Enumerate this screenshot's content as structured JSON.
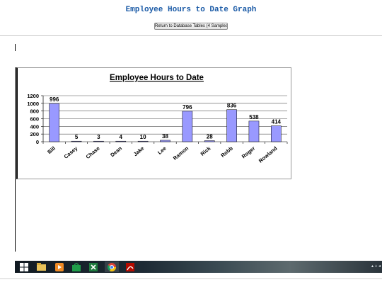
{
  "page": {
    "title": "Employee Hours to Date Graph",
    "return_button": "Return to Database Tables (4 Samples)"
  },
  "chart_data": {
    "type": "bar",
    "title": "Employee Hours to Date",
    "categories": [
      "Bill",
      "Casey",
      "Chase",
      "Dean",
      "Jake",
      "Lee",
      "Ramon",
      "Rick",
      "Robb",
      "Roger",
      "Rowland"
    ],
    "values": [
      996,
      5,
      3,
      4,
      10,
      38,
      796,
      28,
      836,
      538,
      414
    ],
    "ylim": [
      0,
      1200
    ],
    "yticks": [
      0,
      200,
      400,
      600,
      800,
      1000,
      1200
    ],
    "grid": true,
    "bar_color": "#9999ff",
    "xlabel": "",
    "ylabel": ""
  },
  "taskbar": {
    "items": [
      {
        "icon": "windows-start-icon"
      },
      {
        "icon": "file-explorer-icon"
      },
      {
        "icon": "media-player-icon"
      },
      {
        "icon": "store-icon"
      },
      {
        "icon": "excel-icon"
      },
      {
        "icon": "chrome-icon"
      },
      {
        "icon": "acrobat-icon"
      }
    ],
    "tray": "▴ ⌂ ◂"
  },
  "colors": {
    "title_blue": "#1a5aa6",
    "bar": "#9999ff"
  }
}
